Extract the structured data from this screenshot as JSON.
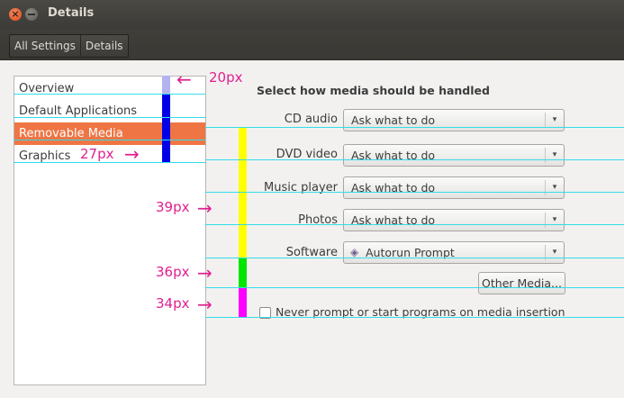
{
  "window": {
    "title": "Details",
    "close_glyph": "×"
  },
  "breadcrumb": {
    "items": [
      "All Settings",
      "Details"
    ]
  },
  "sidebar": {
    "items": [
      "Overview",
      "Default Applications",
      "Removable Media",
      "Graphics"
    ],
    "selected": 2
  },
  "main": {
    "heading": "Select how media should be handled",
    "fields": [
      {
        "label": "CD audio",
        "value": "Ask what to do"
      },
      {
        "label": "DVD video",
        "value": "Ask what to do"
      },
      {
        "label": "Music player",
        "value": "Ask what to do"
      },
      {
        "label": "Photos",
        "value": "Ask what to do"
      },
      {
        "label": "Software",
        "value": "Autorun Prompt",
        "icon": "autorun-icon"
      }
    ],
    "other_media_button": "Other Media...",
    "never_prompt": {
      "label": "Never prompt or start programs on media insertion",
      "checked": false
    }
  },
  "annotations": {
    "measurements": [
      "20px",
      "27px",
      "39px",
      "36px",
      "34px"
    ],
    "arrow_glyph": "→",
    "arrow_left_glyph": "←",
    "colors": {
      "guide": "#33dde8",
      "label": "#e0208f",
      "lavender": "#b3b3f0",
      "blue": "#0000e6",
      "yellow": "#ffff00",
      "green": "#00e600",
      "magenta": "#ff00ff"
    }
  },
  "icons": {
    "dropdown": "▾",
    "autorun": "◈"
  }
}
